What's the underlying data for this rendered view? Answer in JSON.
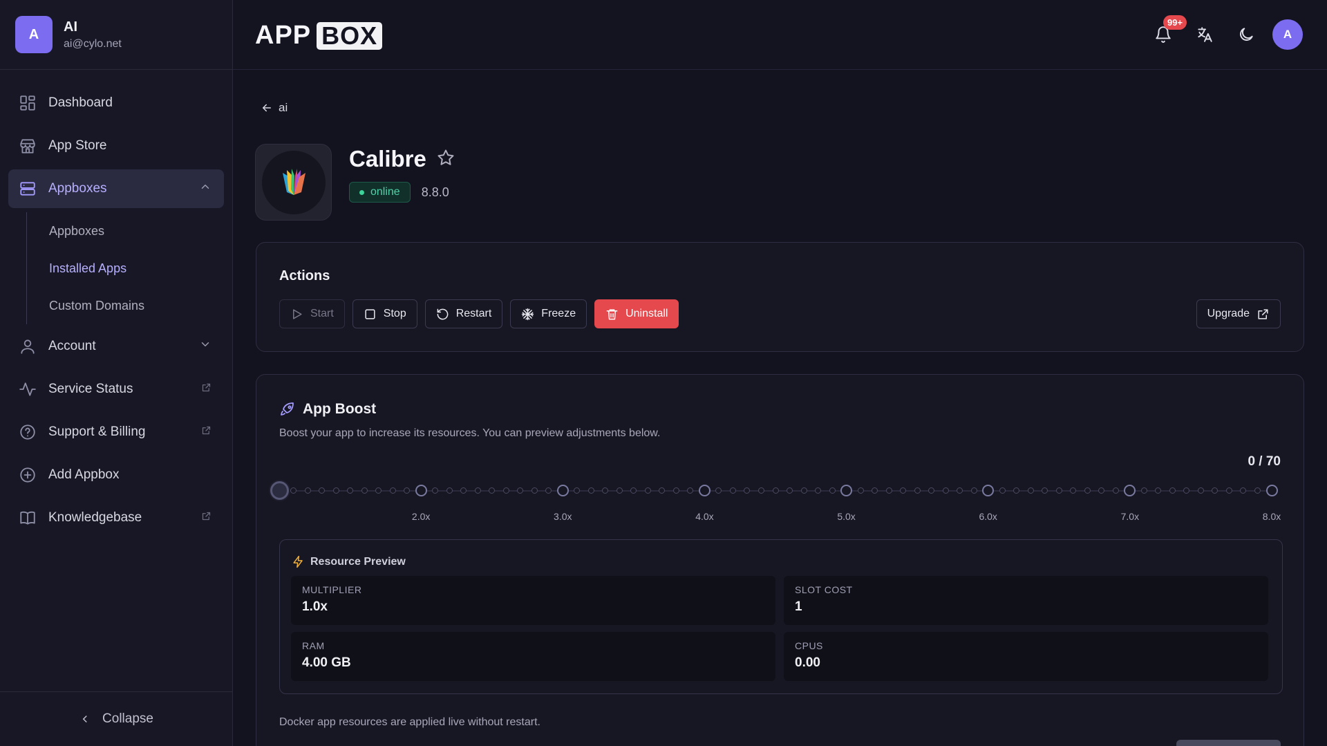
{
  "user": {
    "avatar_letter": "A",
    "name": "AI",
    "email": "ai@cylo.net"
  },
  "sidebar": {
    "items": [
      {
        "label": "Dashboard",
        "icon": "dashboard-icon"
      },
      {
        "label": "App Store",
        "icon": "store-icon"
      },
      {
        "label": "Appboxes",
        "icon": "server-icon"
      },
      {
        "label": "Account",
        "icon": "user-icon"
      },
      {
        "label": "Service Status",
        "icon": "activity-icon"
      },
      {
        "label": "Support & Billing",
        "icon": "help-circle-icon"
      },
      {
        "label": "Add Appbox",
        "icon": "plus-circle-icon"
      },
      {
        "label": "Knowledgebase",
        "icon": "book-icon"
      }
    ],
    "subitems": [
      "Appboxes",
      "Installed Apps",
      "Custom Domains"
    ],
    "collapse_label": "Collapse"
  },
  "header": {
    "logo_part1": "APP",
    "logo_part2": "BOX",
    "notification_badge": "99+",
    "avatar_letter": "A"
  },
  "app": {
    "back_label": "ai",
    "name": "Calibre",
    "status": "online",
    "version": "8.8.0"
  },
  "actions": {
    "title": "Actions",
    "start": "Start",
    "stop": "Stop",
    "restart": "Restart",
    "freeze": "Freeze",
    "uninstall": "Uninstall",
    "upgrade": "Upgrade"
  },
  "boost": {
    "title": "App Boost",
    "description": "Boost your app to increase its resources. You can preview adjustments below.",
    "count": "0 / 70",
    "slider_value": 0,
    "slider_max": 70,
    "marks": [
      "2.0x",
      "3.0x",
      "4.0x",
      "5.0x",
      "6.0x",
      "7.0x",
      "8.0x"
    ],
    "note": "Docker app resources are applied live without restart."
  },
  "preview": {
    "title": "Resource Preview",
    "multiplier_label": "MULTIPLIER",
    "multiplier_value": "1.0x",
    "slot_cost_label": "SLOT COST",
    "slot_cost_value": "1",
    "ram_label": "RAM",
    "ram_value": "4.00 GB",
    "cpus_label": "CPUS",
    "cpus_value": "0.00"
  },
  "colors": {
    "accent": "#a59cff",
    "danger": "#e5484d",
    "online": "#3cd49a"
  }
}
